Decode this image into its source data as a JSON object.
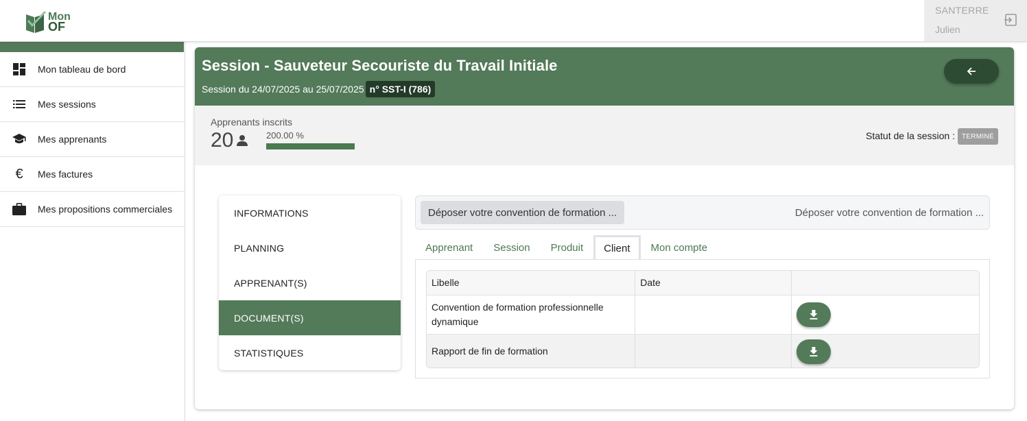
{
  "brand": {
    "line1": "Mon",
    "line2": "OF"
  },
  "user": {
    "last_name": "SANTERRE",
    "first_name": "Julien"
  },
  "sidebar": {
    "items": [
      {
        "label": "Mon tableau de bord",
        "icon": "dashboard-icon"
      },
      {
        "label": "Mes sessions",
        "icon": "list-icon"
      },
      {
        "label": "Mes apprenants",
        "icon": "graduation-cap-icon"
      },
      {
        "label": "Mes factures",
        "icon": "euro-icon"
      },
      {
        "label": "Mes propositions commerciales",
        "icon": "briefcase-icon"
      }
    ]
  },
  "session": {
    "title": "Session - Sauveteur Secouriste du Travail Initiale",
    "dates": "Session du 24/07/2025 au 25/07/2025",
    "number": "n° SST-I (786)"
  },
  "stats": {
    "registered_label": "Apprenants inscrits",
    "registered_count": "20",
    "fill_rate": "200.00 %",
    "fill_fraction": 1.0,
    "status_label": "Statut de la session :",
    "status_value": "TERMINÉ"
  },
  "menu": {
    "items": [
      "INFORMATIONS",
      "PLANNING",
      "APPRENANT(S)",
      "DOCUMENT(S)",
      "STATISTIQUES"
    ],
    "active": "DOCUMENT(S)"
  },
  "upload": {
    "button_label": "Déposer votre convention de formation ...",
    "filename_text": "Déposer votre convention de formation ..."
  },
  "tabs": {
    "items": [
      "Apprenant",
      "Session",
      "Produit",
      "Client",
      "Mon compte"
    ],
    "active": "Client"
  },
  "documents": {
    "columns": [
      "Libelle",
      "Date",
      ""
    ],
    "rows": [
      {
        "libelle": "Convention de formation professionnelle dynamique",
        "date": ""
      },
      {
        "libelle": "Rapport de fin de formation",
        "date": ""
      }
    ]
  },
  "colors": {
    "primary": "#537a59",
    "dark": "#2d4a32",
    "badge": "#9e9e9e"
  }
}
